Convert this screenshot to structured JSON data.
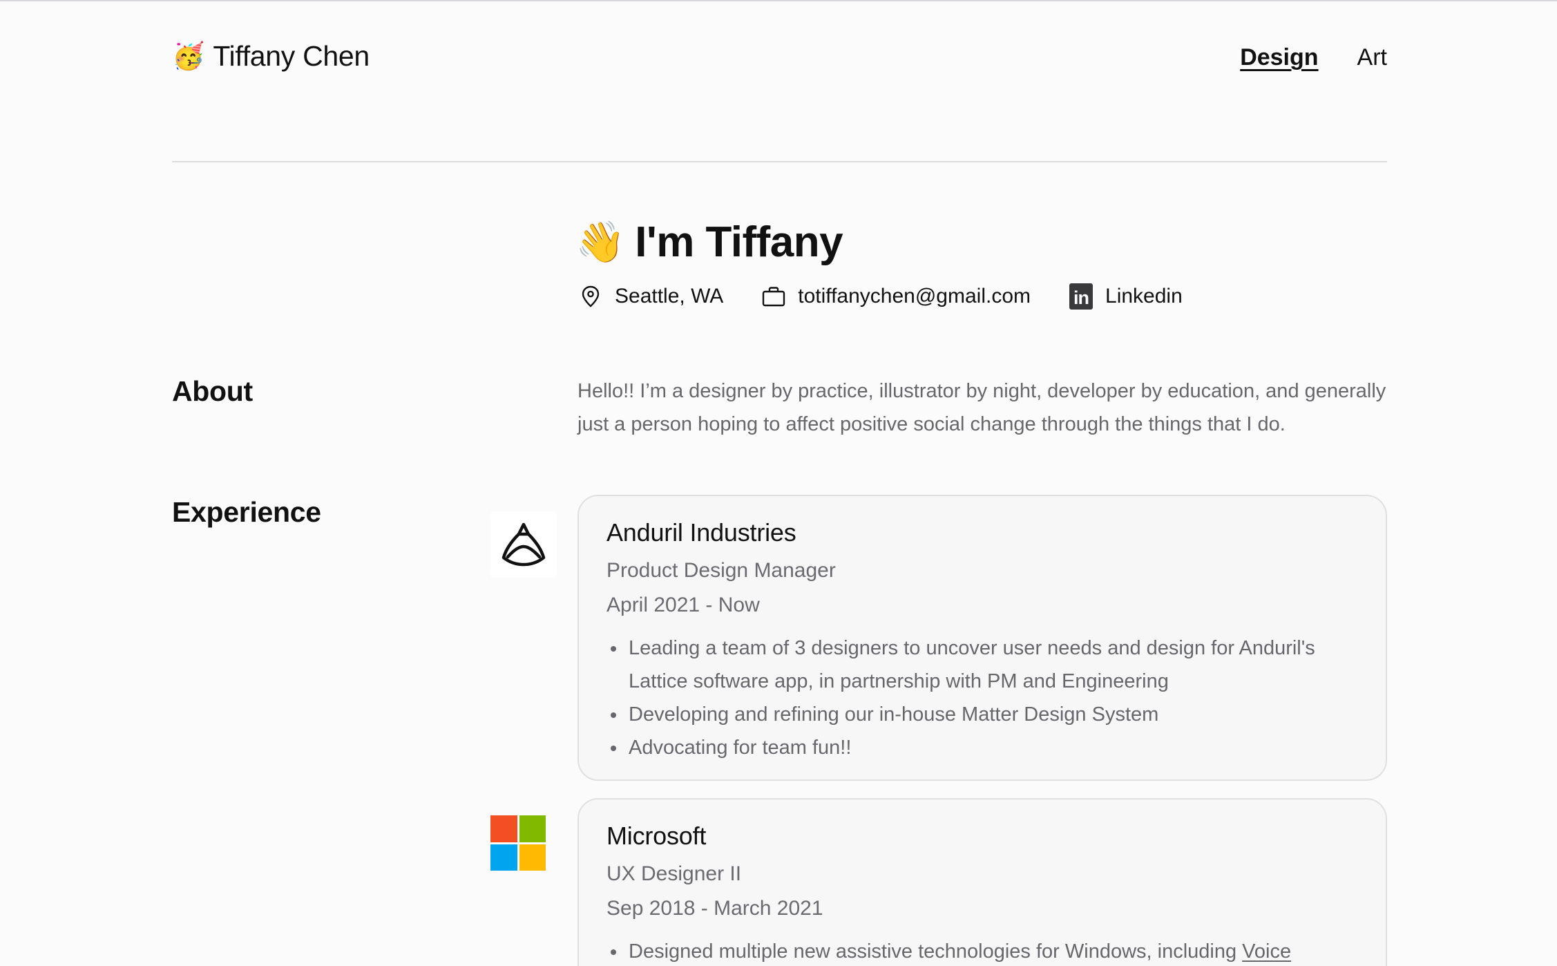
{
  "header": {
    "brand_emoji": "🥳",
    "brand_name": "Tiffany Chen",
    "nav": [
      {
        "label": "Design",
        "active": true
      },
      {
        "label": "Art",
        "active": false
      }
    ]
  },
  "hero": {
    "emoji": "👋",
    "title": "I'm Tiffany",
    "contacts": {
      "location": {
        "icon": "location-pin-icon",
        "text": "Seattle, WA"
      },
      "email": {
        "icon": "briefcase-icon",
        "text": "totiffanychen@gmail.com"
      },
      "linkedin": {
        "icon": "linkedin-icon",
        "text": "Linkedin"
      }
    }
  },
  "about": {
    "label": "About",
    "text": "Hello!! I’m a designer by practice, illustrator by night, developer by education, and generally just a person hoping to affect positive social change through the things that I do."
  },
  "experience": {
    "label": "Experience",
    "jobs": [
      {
        "company": "Anduril Industries",
        "role": "Product Design Manager",
        "dates": "April 2021 - Now",
        "logo": "anduril-logo",
        "bullets": [
          "Leading a team of 3 designers to uncover user needs and design for Anduril's Lattice software app, in partnership with PM and Engineering",
          "Developing and refining our in-house Matter Design System",
          "Advocating for team fun!!"
        ]
      },
      {
        "company": "Microsoft",
        "role": "UX Designer II",
        "dates": "Sep 2018 - March 2021",
        "logo": "microsoft-logo",
        "bullets_prefix": "Designed multiple new assistive technologies for Windows, including ",
        "bullets_link": "Voice"
      }
    ]
  },
  "colors": {
    "background": "#fbfbfc",
    "card_bg": "#f7f7f8",
    "card_border": "#e0e0e3",
    "muted_text": "#66666b",
    "ms_red": "#f25022",
    "ms_green": "#7fba00",
    "ms_blue": "#00a4ef",
    "ms_yellow": "#ffb900"
  }
}
